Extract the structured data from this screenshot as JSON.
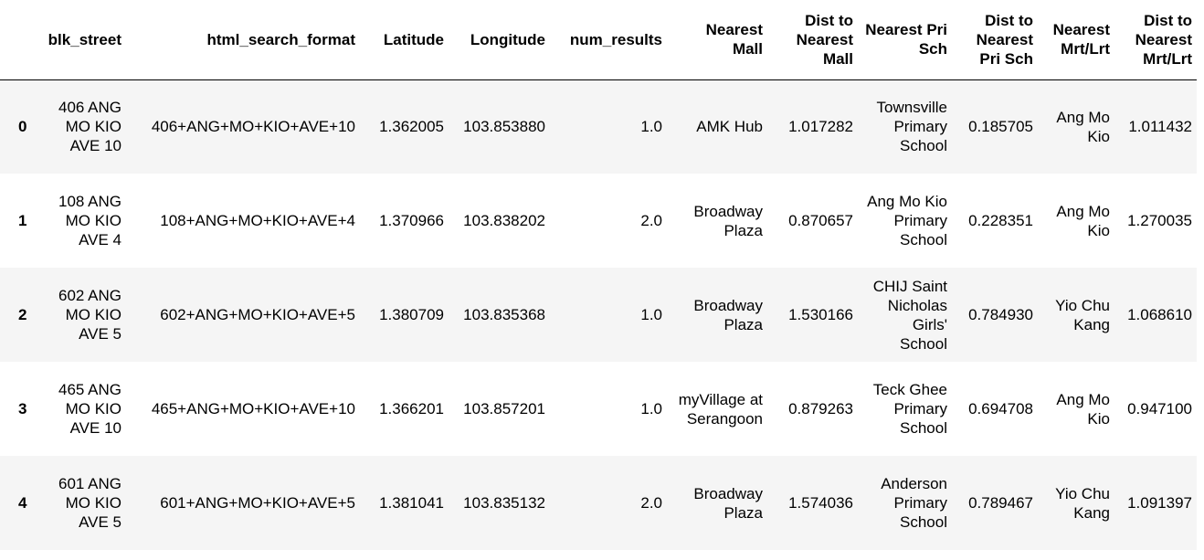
{
  "table": {
    "index_header": "",
    "columns": [
      "blk_street",
      "html_search_format",
      "Latitude",
      "Longitude",
      "num_results",
      "Nearest Mall",
      "Dist to Nearest Mall",
      "Nearest Pri Sch",
      "Dist to Nearest Pri Sch",
      "Nearest Mrt/Lrt",
      "Dist to Nearest Mrt/Lrt"
    ],
    "rows": [
      {
        "index": "0",
        "cells": [
          "406 ANG MO KIO AVE 10",
          "406+ANG+MO+KIO+AVE+10",
          "1.362005",
          "103.853880",
          "1.0",
          "AMK Hub",
          "1.017282",
          "Townsville Primary School",
          "0.185705",
          "Ang Mo Kio",
          "1.011432"
        ]
      },
      {
        "index": "1",
        "cells": [
          "108 ANG MO KIO AVE 4",
          "108+ANG+MO+KIO+AVE+4",
          "1.370966",
          "103.838202",
          "2.0",
          "Broadway Plaza",
          "0.870657",
          "Ang Mo Kio Primary School",
          "0.228351",
          "Ang Mo Kio",
          "1.270035"
        ]
      },
      {
        "index": "2",
        "cells": [
          "602 ANG MO KIO AVE 5",
          "602+ANG+MO+KIO+AVE+5",
          "1.380709",
          "103.835368",
          "1.0",
          "Broadway Plaza",
          "1.530166",
          "CHIJ Saint Nicholas Girls' School",
          "0.784930",
          "Yio Chu Kang",
          "1.068610"
        ]
      },
      {
        "index": "3",
        "cells": [
          "465 ANG MO KIO AVE 10",
          "465+ANG+MO+KIO+AVE+10",
          "1.366201",
          "103.857201",
          "1.0",
          "myVillage at Serangoon",
          "0.879263",
          "Teck Ghee Primary School",
          "0.694708",
          "Ang Mo Kio",
          "0.947100"
        ]
      },
      {
        "index": "4",
        "cells": [
          "601 ANG MO KIO AVE 5",
          "601+ANG+MO+KIO+AVE+5",
          "1.381041",
          "103.835132",
          "2.0",
          "Broadway Plaza",
          "1.574036",
          "Anderson Primary School",
          "0.789467",
          "Yio Chu Kang",
          "1.091397"
        ]
      }
    ]
  }
}
